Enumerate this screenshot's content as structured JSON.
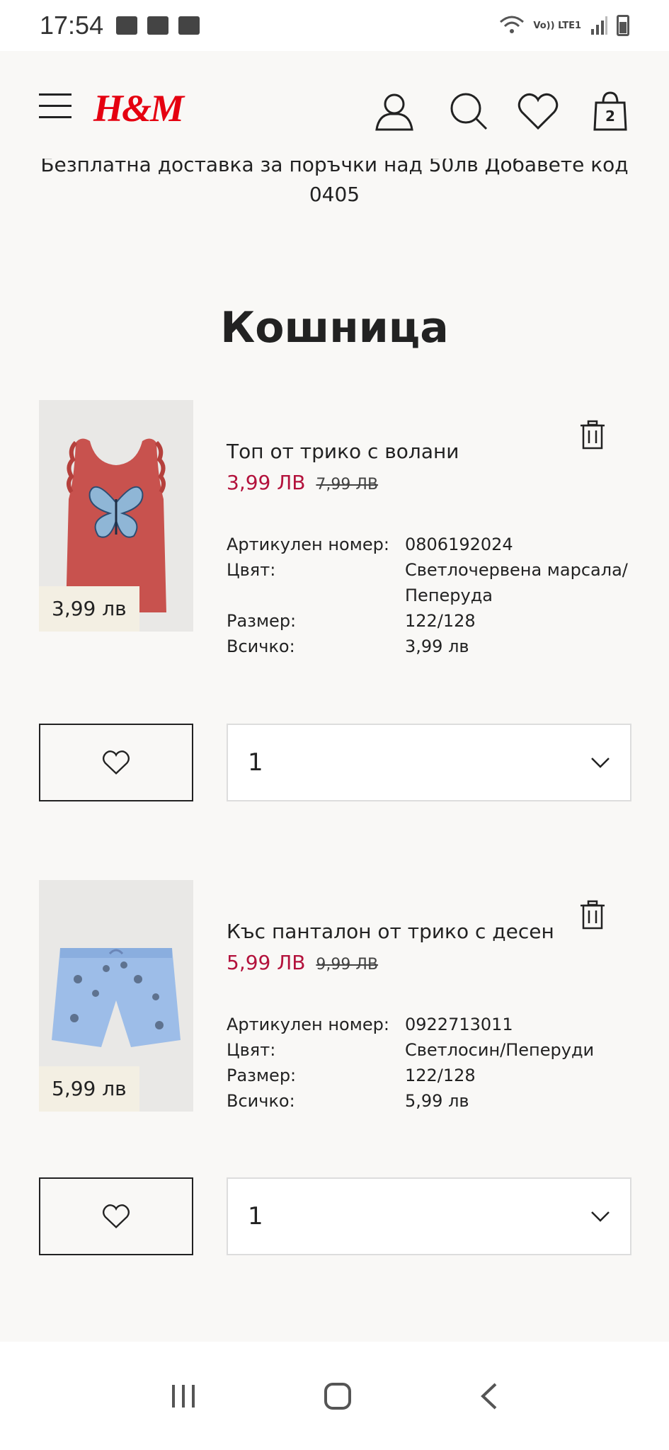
{
  "status_bar": {
    "time": "17:54",
    "network": "Vo)) LTE1"
  },
  "header": {
    "logo": "H&M",
    "cart_count": "2"
  },
  "promo": {
    "text": "Безплатна доставка за поръчки над 50лв Добавете код 0405"
  },
  "page_title": "Кошница",
  "labels": {
    "article": "Артикулен номер:",
    "color": "Цвят:",
    "size": "Размер:",
    "total": "Всичко:"
  },
  "items": [
    {
      "name": "Топ от трико с волани",
      "price": "3,99 ЛВ",
      "old_price": "7,99 ЛВ",
      "thumb_price": "3,99 лв",
      "article": "0806192024",
      "color": "Светлочервена марсала/ Пеперуда",
      "size": "122/128",
      "total": "3,99 лв",
      "quantity": "1"
    },
    {
      "name": "Къс панталон от трико с десен",
      "price": "5,99 ЛВ",
      "old_price": "9,99 ЛВ",
      "thumb_price": "5,99 лв",
      "article": "0922713011",
      "color": "Светлосин/Пеперуди",
      "size": "122/128",
      "total": "5,99 лв",
      "quantity": "1"
    }
  ],
  "colors": {
    "accent_price": "#b3123c",
    "brand": "#e50010",
    "background": "#f9f8f6"
  }
}
